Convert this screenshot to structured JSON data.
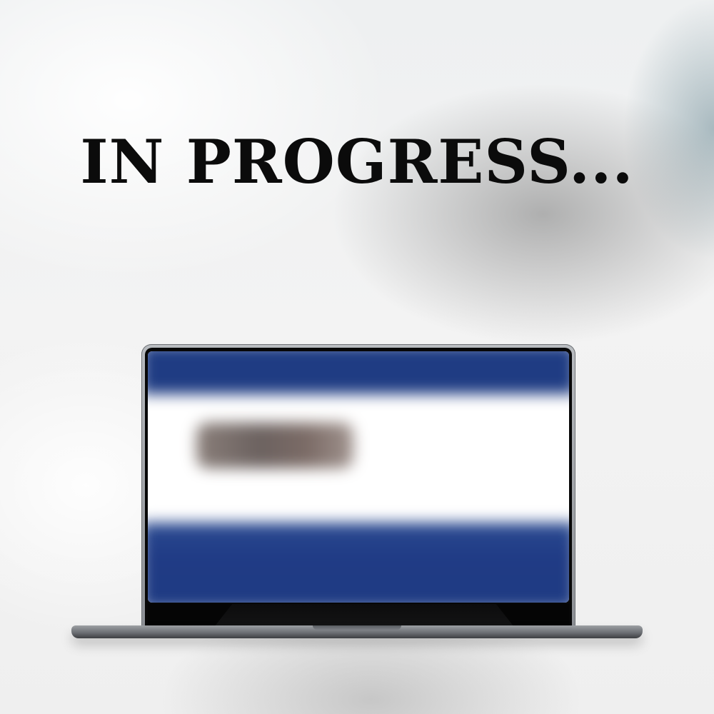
{
  "headline": {
    "text": "IN PROGRESS..."
  },
  "laptop": {
    "screen_colors": {
      "primary_band": "#1f3c83",
      "content_background": "#ffffff",
      "blurred_block": "#7a6e6a"
    },
    "frame_color": "#8d9095"
  }
}
